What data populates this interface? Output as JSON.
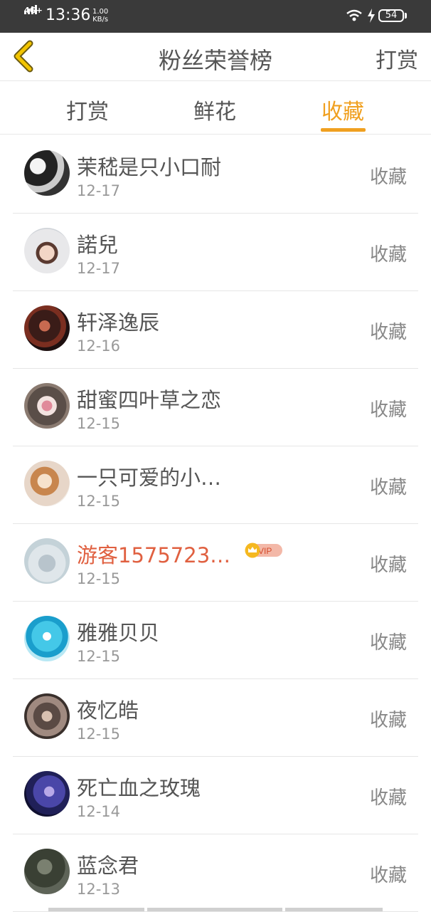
{
  "statusbar": {
    "network": "4G+",
    "time": "13:36",
    "speed_value": "1.00",
    "speed_unit": "KB/s",
    "battery": "54"
  },
  "header": {
    "title": "粉丝荣誉榜",
    "right_action": "打赏"
  },
  "tabs": [
    {
      "label": "打赏",
      "active": false
    },
    {
      "label": "鲜花",
      "active": false
    },
    {
      "label": "收藏",
      "active": true
    }
  ],
  "accent_color": "#f0a020",
  "vip_badge": "VIP",
  "list": [
    {
      "name": "茉嵇是只小口耐",
      "date": "12-17",
      "action": "收藏",
      "vip": false
    },
    {
      "name": "諾兒",
      "date": "12-17",
      "action": "收藏",
      "vip": false
    },
    {
      "name": "轩泽逸辰",
      "date": "12-16",
      "action": "收藏",
      "vip": false
    },
    {
      "name": "甜蜜四叶草之恋",
      "date": "12-15",
      "action": "收藏",
      "vip": false
    },
    {
      "name": "一只可爱的小…",
      "date": "12-15",
      "action": "收藏",
      "vip": false
    },
    {
      "name": "游客1575723…",
      "date": "12-15",
      "action": "收藏",
      "vip": true
    },
    {
      "name": "雅雅贝贝",
      "date": "12-15",
      "action": "收藏",
      "vip": false
    },
    {
      "name": "夜忆皓",
      "date": "12-15",
      "action": "收藏",
      "vip": false
    },
    {
      "name": "死亡血之玫瑰",
      "date": "12-14",
      "action": "收藏",
      "vip": false
    },
    {
      "name": "蓝念君",
      "date": "12-13",
      "action": "收藏",
      "vip": false
    }
  ]
}
